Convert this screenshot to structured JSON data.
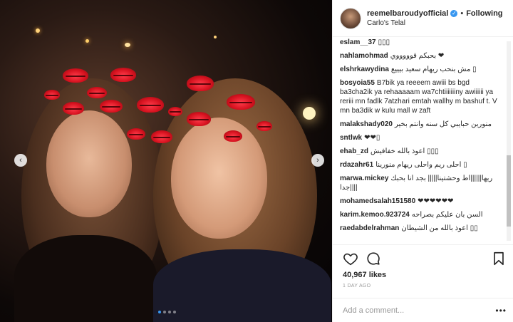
{
  "post": {
    "author": "reemelbaroudyofficial",
    "follow_label": "Following",
    "location": "Carlo's Telal",
    "separator": "•",
    "verified_glyph": "✓"
  },
  "comments": [
    {
      "user": "eslam__37",
      "text": "▯▯▯"
    },
    {
      "user": "nahlamohmad",
      "text": "بحبكم قوووووي ❤"
    },
    {
      "user": "elshrkawydina",
      "text": "مش بنحب ريهام سعيد بيييع ▯"
    },
    {
      "user": "bosyoia55",
      "text": "B7bik ya reeeem awiii bs bgd ba3cha2ik ya rehaaaaam wa7chtiiiiiiiny awiiiiii ya reriii mn fadlk 7atzhari emtah wallhy m bashuf t. V mn ba3dik w kulu mall w zaft"
    },
    {
      "user": "malakshady020",
      "text": "منورين حبايبي كل سنه وانتم بخير"
    },
    {
      "user": "sntlwk",
      "text": "❤❤▯"
    },
    {
      "user": "ehab_zd",
      "text": "اعوذ بالله خفافيش ▯▯▯"
    },
    {
      "user": "rdazahr61",
      "text": "احلى ريم واحلى ريهام منورينا ▯"
    },
    {
      "user": "marwa.mickey",
      "text": "ريها||||||اط وحشتينا||||| بجد انا بحبك جدا||||"
    },
    {
      "user": "mohamedsalah151580",
      "text": "❤❤❤❤❤❤"
    },
    {
      "user": "karim.kemoo.923724",
      "text": "السن بان عليكم بصراحه"
    },
    {
      "user": "raedabdelrahman",
      "text": "اعوذ بالله من الشيطان ▯▯"
    }
  ],
  "actions": {
    "likes": "40,967 likes",
    "timestamp": "1 DAY AGO",
    "icons": [
      "heart-icon",
      "comment-icon",
      "bookmark-icon"
    ]
  },
  "composer": {
    "placeholder": "Add a comment...",
    "more_glyph": "•••"
  },
  "carousel": {
    "prev_glyph": "‹",
    "next_glyph": "›",
    "slide_count": 4,
    "active_index": 0
  },
  "colors": {
    "accent": "#3897f0",
    "text": "#262626",
    "muted": "#999999",
    "border": "#efefef"
  }
}
